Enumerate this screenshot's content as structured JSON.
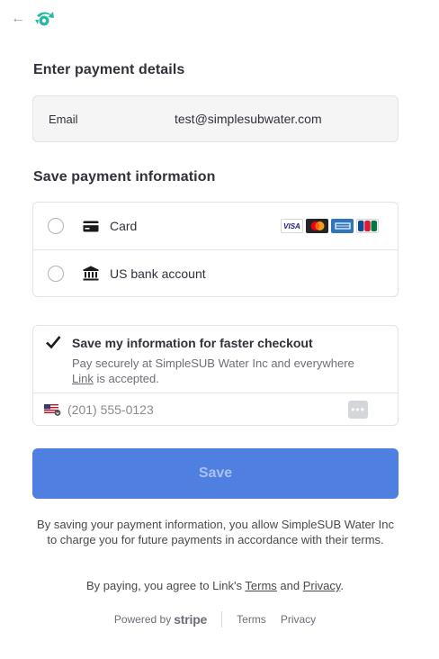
{
  "header": {
    "back_icon": "arrow-left-icon",
    "logo_icon": "simplesub-logo-icon",
    "logo_color": "#2bb8a3"
  },
  "payment_details": {
    "title": "Enter payment details",
    "email_label": "Email",
    "email_value": "test@simplesubwater.com"
  },
  "save_info": {
    "title": "Save payment information",
    "methods": [
      {
        "label": "Card",
        "icon": "card-icon",
        "brands": [
          "VISA",
          "Mastercard",
          "American Express",
          "JCB"
        ]
      },
      {
        "label": "US bank account",
        "icon": "bank-icon"
      }
    ]
  },
  "link": {
    "checked": true,
    "title": "Save my information for faster checkout",
    "desc_prefix": "Pay securely at SimpleSUB Water Inc and everywhere ",
    "desc_link": "Link",
    "desc_suffix": " is accepted.",
    "phone_placeholder": "(201) 555-0123",
    "flag_icon": "us-flag-icon",
    "more_icon": "more-dots-icon"
  },
  "save_button": {
    "label": "Save",
    "color": "#4f7fe0"
  },
  "consent_text": "By saving your payment information, you allow SimpleSUB Water Inc to charge you for future payments in accordance with their terms.",
  "terms": {
    "prefix": "By paying, you agree to Link's ",
    "terms": "Terms",
    "and": " and ",
    "privacy": "Privacy",
    "end": "."
  },
  "footer": {
    "powered_by": "Powered by",
    "brand": "stripe",
    "terms": "Terms",
    "privacy": "Privacy"
  }
}
